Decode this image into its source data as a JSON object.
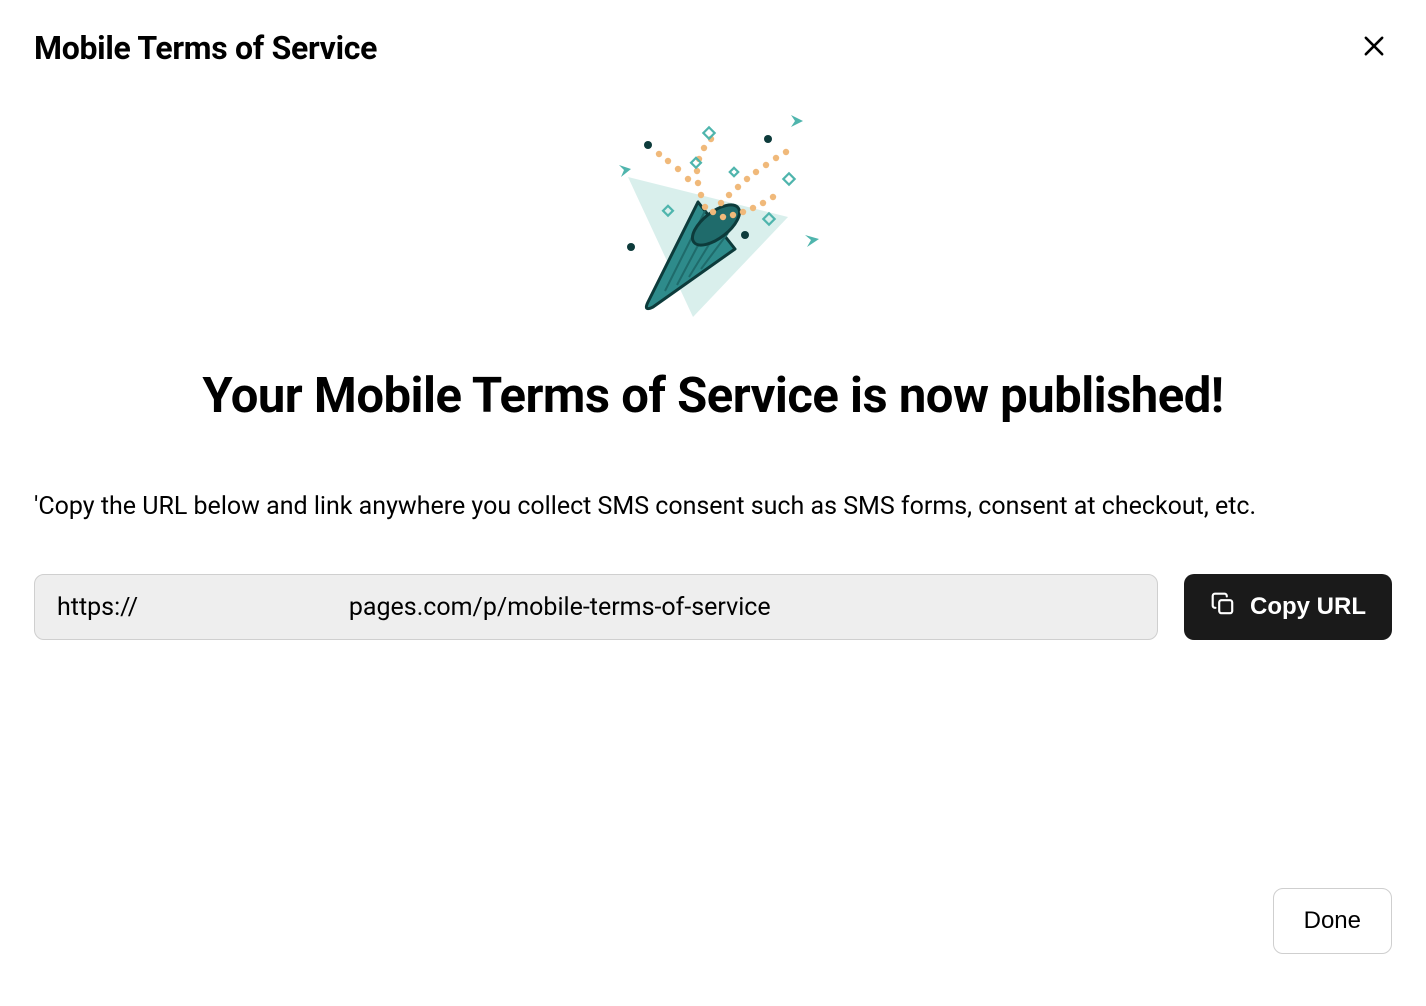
{
  "header": {
    "title": "Mobile Terms of Service"
  },
  "main": {
    "headline": "Your Mobile Terms of Service is now published!",
    "description": "'Copy the URL below and link anywhere you collect SMS consent such as SMS forms, consent at checkout, etc.",
    "url_value": "https://                                  pages.com/p/mobile-terms-of-service",
    "copy_button_label": "Copy URL"
  },
  "footer": {
    "done_label": "Done"
  }
}
